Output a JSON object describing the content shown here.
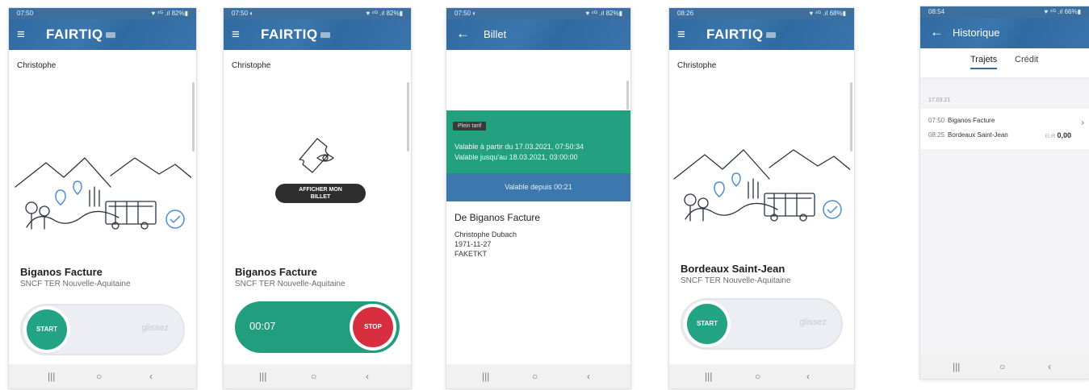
{
  "screens": [
    {
      "status": {
        "time": "07:50",
        "right": "♥ ⁴ᴳ .ıl 82%▮"
      },
      "brand": "FAIRTIQ",
      "user": "Christophe",
      "station": "Biganos Facture",
      "operator": "SNCF TER Nouvelle-Aquitaine",
      "slider": {
        "button": "START",
        "hint": "glissez"
      }
    },
    {
      "status": {
        "time": "07:50 ◐",
        "right": "♥ ⁴ᴳ .ıl 82%▮"
      },
      "brand": "FAIRTIQ",
      "user": "Christophe",
      "show_ticket_line1": "AFFICHER MON",
      "show_ticket_line2": "BILLET",
      "station": "Biganos Facture",
      "operator": "SNCF TER Nouvelle-Aquitaine",
      "timer": "00:07",
      "stop": "STOP"
    },
    {
      "status": {
        "time": "07:50 ◐",
        "right": "♥ ⁴ᴳ .ıl 82%▮"
      },
      "title": "Billet",
      "badge": "Plein tarif",
      "valid_from": "Valable à partir du 17.03.2021, 07:50:34",
      "valid_until": "Valable jusqu'au 18.03.2021, 03:00:00",
      "valid_since": "Valable depuis 00:21",
      "from": "De Biganos Facture",
      "passenger_name": "Christophe Dubach",
      "birthdate": "1971-11-27",
      "ticket_code": "FAKETKT"
    },
    {
      "status": {
        "time": "08:26",
        "right": "♥ ⁴ᴳ .ıl 68%▮"
      },
      "brand": "FAIRTIQ",
      "user": "Christophe",
      "station": "Bordeaux Saint-Jean",
      "operator": "SNCF TER Nouvelle-Aquitaine",
      "slider": {
        "button": "START",
        "hint": "glissez"
      }
    },
    {
      "status": {
        "time": "08:54",
        "right": "♥ ⁴ᴳ .ıl 66%▮"
      },
      "title": "Historique",
      "tabs": [
        "Trajets",
        "Crédit"
      ],
      "date": "17.03.21",
      "trip": {
        "dep_time": "07:50",
        "dep_station": "Biganos Facture",
        "arr_time": "08:25",
        "arr_station": "Bordeaux Saint-Jean",
        "currency": "EUR",
        "price": "0,00"
      }
    }
  ],
  "nav": {
    "recent": "|||",
    "home": "○",
    "back": "‹"
  },
  "icons": {
    "menu": "≡",
    "back": "←",
    "chevron": "›"
  },
  "colors": {
    "appbar": "#2f6aa1",
    "green": "#22a384",
    "stop_red": "#d72f3f",
    "ticket_blue": "#3c77ad"
  }
}
